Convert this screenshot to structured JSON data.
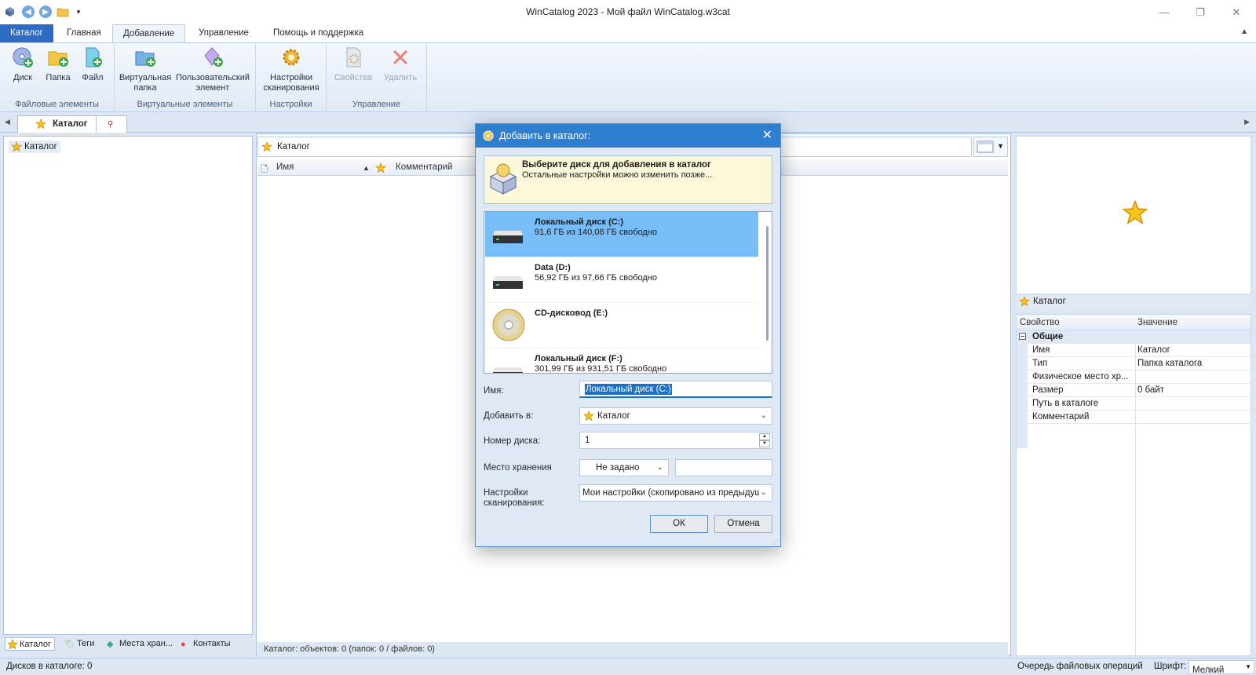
{
  "window": {
    "title": "WinCatalog 2023 - Мой файл WinCatalog.w3cat",
    "minimize": "—",
    "restore": "❐",
    "close": "✕"
  },
  "ribbon": {
    "file_tab": "Каталог",
    "tabs": [
      "Главная",
      "Добавление",
      "Управление",
      "Помощь и поддержка"
    ],
    "groups": {
      "file_elements": {
        "label": "Файловые элементы",
        "disk": "Диск",
        "folder": "Папка",
        "file": "Файл"
      },
      "virtual_elements": {
        "label": "Виртуальные элементы",
        "virtual_folder_1": "Виртуальная",
        "virtual_folder_2": "папка",
        "user_element_1": "Пользовательский",
        "user_element_2": "элемент"
      },
      "settings": {
        "label": "Настройки",
        "scan_1": "Настройки",
        "scan_2": "сканирования"
      },
      "manage": {
        "label": "Управление",
        "properties": "Свойства",
        "delete": "Удалить"
      }
    }
  },
  "doc_tab": {
    "label": "Каталог"
  },
  "tree": {
    "root": "Каталог"
  },
  "bottom_tabs": [
    "Каталог",
    "Теги",
    "Места хран...",
    "Контакты"
  ],
  "main": {
    "path": "Каталог",
    "columns": {
      "name": "Имя",
      "comment": "Комментарий"
    },
    "status": "Каталог: объектов: 0 (папок: 0 / файлов: 0)"
  },
  "right": {
    "preview_caption": "Каталог",
    "props_header": {
      "property": "Свойство",
      "value": "Значение"
    },
    "group": "Общие",
    "rows": [
      {
        "k": "Имя",
        "v": "Каталог"
      },
      {
        "k": "Тип",
        "v": "Папка каталога"
      },
      {
        "k": "Физическое место хр...",
        "v": ""
      },
      {
        "k": "Размер",
        "v": "0 байт"
      },
      {
        "k": "Путь в каталоге",
        "v": ""
      },
      {
        "k": "Комментарий",
        "v": ""
      }
    ]
  },
  "statusbar": {
    "disks": "Дисков в каталоге: 0",
    "queue": "Очередь файловых операций",
    "font_label": "Шрифт:",
    "font_value": "Мелкий"
  },
  "dialog": {
    "title": "Добавить в каталог:",
    "header_title": "Выберите диск для добавления в каталог",
    "header_sub": "Остальные настройки можно изменить позже...",
    "drives": [
      {
        "name": "Локальный диск (C:)",
        "space": "91,6 ГБ из 140,08 ГБ свободно",
        "icon": "hdd-icon",
        "selected": true
      },
      {
        "name": "Data (D:)",
        "space": "56,92 ГБ из 97,66 ГБ свободно",
        "icon": "hdd-icon",
        "selected": false
      },
      {
        "name": "CD-дисковод (E:)",
        "space": "",
        "icon": "cd-icon",
        "selected": false
      },
      {
        "name": "Локальный диск (F:)",
        "space": "301,99 ГБ из 931,51 ГБ свободно",
        "icon": "hdd-icon",
        "selected": false
      }
    ],
    "fields": {
      "name_label": "Имя:",
      "name_value": "Локальный диск (C:)",
      "add_to_label": "Добавить в:",
      "add_to_value": "Каталог",
      "disk_no_label": "Номер диска:",
      "disk_no_value": "1",
      "storage_label": "Место хранения",
      "storage_value": "Не задано",
      "scan_label_1": "Настройки",
      "scan_label_2": "сканирования:",
      "scan_value": "Мои настройки (скопировано из предыдуще"
    },
    "ok": "ОК",
    "cancel": "Отмена"
  }
}
